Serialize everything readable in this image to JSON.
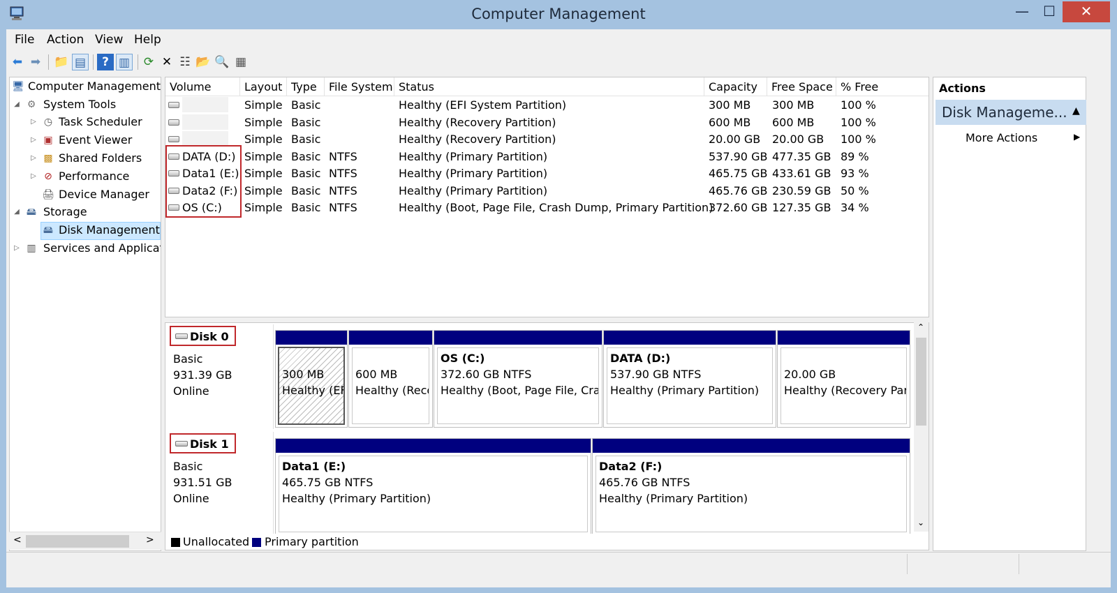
{
  "window": {
    "title": "Computer Management",
    "min_label": "—",
    "max_label": "☐",
    "close_label": "✕"
  },
  "menu": [
    "File",
    "Action",
    "View",
    "Help"
  ],
  "toolbar": {
    "icons": [
      "back-arrow-icon",
      "forward-arrow-icon",
      "up-folder-icon",
      "show-hide-tree-icon",
      "help-icon",
      "show-action-pane-icon",
      "refresh-icon",
      "delete-icon",
      "properties-icon",
      "open-icon",
      "search-icon",
      "export-icon"
    ]
  },
  "tree": {
    "items": [
      {
        "label": "Computer Management",
        "icon": "computer-management-icon"
      },
      {
        "label": "System Tools",
        "icon": "system-tools-icon"
      },
      {
        "label": "Task Scheduler",
        "icon": "task-scheduler-icon"
      },
      {
        "label": "Event Viewer",
        "icon": "event-viewer-icon"
      },
      {
        "label": "Shared Folders",
        "icon": "shared-folders-icon"
      },
      {
        "label": "Performance",
        "icon": "performance-icon"
      },
      {
        "label": "Device Manager",
        "icon": "device-manager-icon"
      },
      {
        "label": "Storage",
        "icon": "storage-icon"
      },
      {
        "label": "Disk Management",
        "icon": "disk-management-icon"
      },
      {
        "label": "Services and Applicat",
        "icon": "services-icon"
      }
    ]
  },
  "volumes": {
    "columns": [
      "Volume",
      "Layout",
      "Type",
      "File System",
      "Status",
      "Capacity",
      "Free Space",
      "% Free"
    ],
    "rows": [
      {
        "volume": "",
        "layout": "Simple",
        "type": "Basic",
        "fs": "",
        "status": "Healthy (EFI System Partition)",
        "capacity": "300 MB",
        "free": "300 MB",
        "pct": "100 %"
      },
      {
        "volume": "",
        "layout": "Simple",
        "type": "Basic",
        "fs": "",
        "status": "Healthy (Recovery Partition)",
        "capacity": "600 MB",
        "free": "600 MB",
        "pct": "100 %"
      },
      {
        "volume": "",
        "layout": "Simple",
        "type": "Basic",
        "fs": "",
        "status": "Healthy (Recovery Partition)",
        "capacity": "20.00 GB",
        "free": "20.00 GB",
        "pct": "100 %"
      },
      {
        "volume": "DATA (D:)",
        "layout": "Simple",
        "type": "Basic",
        "fs": "NTFS",
        "status": "Healthy (Primary Partition)",
        "capacity": "537.90 GB",
        "free": "477.35 GB",
        "pct": "89 %"
      },
      {
        "volume": "Data1 (E:)",
        "layout": "Simple",
        "type": "Basic",
        "fs": "NTFS",
        "status": "Healthy (Primary Partition)",
        "capacity": "465.75 GB",
        "free": "433.61 GB",
        "pct": "93 %"
      },
      {
        "volume": "Data2 (F:)",
        "layout": "Simple",
        "type": "Basic",
        "fs": "NTFS",
        "status": "Healthy (Primary Partition)",
        "capacity": "465.76 GB",
        "free": "230.59 GB",
        "pct": "50 %"
      },
      {
        "volume": "OS (C:)",
        "layout": "Simple",
        "type": "Basic",
        "fs": "NTFS",
        "status": "Healthy (Boot, Page File, Crash Dump, Primary Partition)",
        "capacity": "372.60 GB",
        "free": "127.35 GB",
        "pct": "34 %"
      }
    ]
  },
  "disks": [
    {
      "name": "Disk 0",
      "kind": "Basic",
      "size": "931.39 GB",
      "state": "Online",
      "partitions": [
        {
          "title": "",
          "size": "300 MB",
          "status": "Healthy (EF"
        },
        {
          "title": "",
          "size": "600 MB",
          "status": "Healthy (Reco"
        },
        {
          "title": "OS  (C:)",
          "size": "372.60 GB NTFS",
          "status": "Healthy (Boot, Page File, Cras"
        },
        {
          "title": "DATA  (D:)",
          "size": "537.90 GB NTFS",
          "status": "Healthy (Primary Partition)"
        },
        {
          "title": "",
          "size": "20.00 GB",
          "status": "Healthy (Recovery Part"
        }
      ]
    },
    {
      "name": "Disk 1",
      "kind": "Basic",
      "size": "931.51 GB",
      "state": "Online",
      "partitions": [
        {
          "title": "Data1  (E:)",
          "size": "465.75 GB NTFS",
          "status": "Healthy (Primary Partition)"
        },
        {
          "title": "Data2  (F:)",
          "size": "465.76 GB NTFS",
          "status": "Healthy (Primary Partition)"
        }
      ]
    }
  ],
  "legend": {
    "unallocated": "Unallocated",
    "primary": "Primary partition",
    "unallocated_color": "#000000",
    "primary_color": "#00007f"
  },
  "actions": {
    "title": "Actions",
    "section": "Disk Manageme...",
    "more": "More Actions"
  }
}
